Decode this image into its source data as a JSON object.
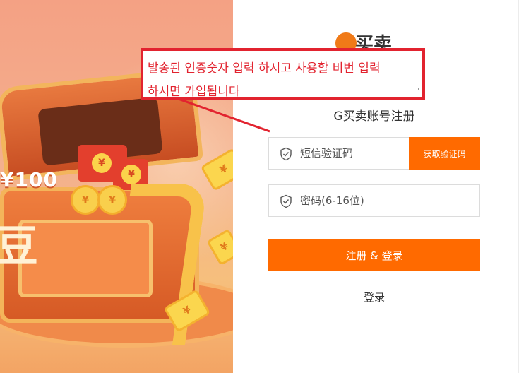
{
  "promo": {
    "amount": "¥100",
    "coin_symbol": "¥",
    "big_char": "豆"
  },
  "logo": {
    "text": "买卖"
  },
  "form": {
    "title": "G买卖账号注册",
    "sms_placeholder": "短信验证码",
    "sms_button": "获取验证码",
    "password_placeholder": "密码(6-16位)",
    "submit_label": "注册 & 登录",
    "login_link": "登录"
  },
  "annotation": {
    "line1": "발송된 인증숫자 입력 하시고 사용할 비번 입력",
    "line2": "하시면 가입됩니다"
  },
  "colors": {
    "accent": "#ff6a00",
    "annotation": "#e2232f"
  }
}
